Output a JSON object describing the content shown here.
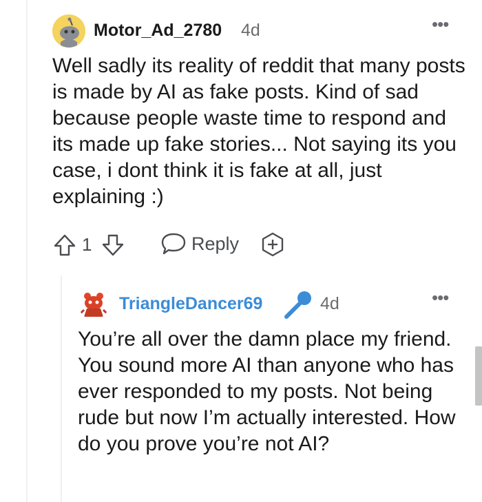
{
  "comments": [
    {
      "username": "Motor_Ad_2780",
      "time": "4d",
      "more": "•••",
      "body": "Well sadly its reality of reddit that many posts is made by AI as fake posts. Kind of sad because people waste time to respond and its made up fake stories... Not saying its you case, i dont think it is fake at all, just explaining :)",
      "score": "1",
      "reply_label": "Reply"
    },
    {
      "username": "TriangleDancer69",
      "time": "4d",
      "more": "•••",
      "body": "You’re all over the damn place my friend. You sound more AI than anyone who has ever responded to my posts. Not being rude but now I’m actually interested. How do you prove you’re not AI?"
    }
  ],
  "icons": {
    "upvote": "arrow-up-icon",
    "downvote": "arrow-down-icon",
    "reply": "speech-bubble-icon",
    "award": "award-plus-icon",
    "more": "more-dots-icon",
    "mic": "microphone-icon"
  },
  "colors": {
    "op_username": "#3c8cd6",
    "muted": "#6a6c6f"
  }
}
